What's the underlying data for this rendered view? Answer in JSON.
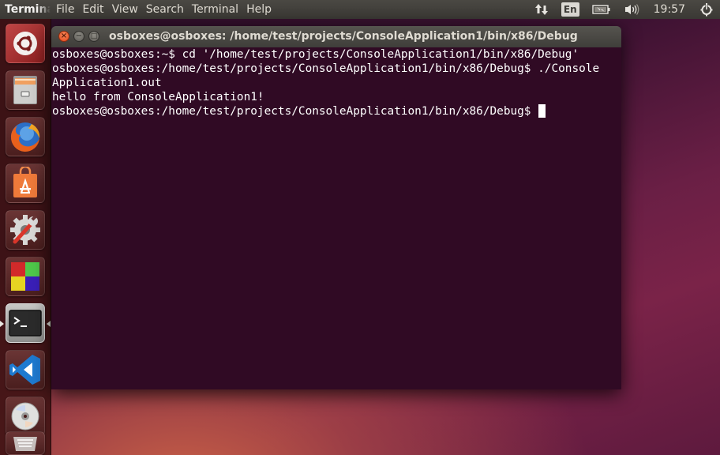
{
  "top_panel": {
    "app_name": "Terminal",
    "menu": [
      "File",
      "Edit",
      "View",
      "Search",
      "Terminal",
      "Help"
    ],
    "indicators": {
      "network_icon": "network-updown-icon",
      "keyboard_layout": "En",
      "battery_icon": "battery-charging-icon",
      "volume_icon": "volume-icon",
      "clock": "19:57",
      "power_icon": "power-gear-icon"
    }
  },
  "launcher": {
    "items": [
      {
        "name": "Dash Home",
        "icon": "ubuntu-logo-icon"
      },
      {
        "name": "Files",
        "icon": "file-cabinet-icon"
      },
      {
        "name": "Firefox Web Browser",
        "icon": "firefox-icon"
      },
      {
        "name": "Ubuntu Software Center",
        "icon": "software-center-bag-icon"
      },
      {
        "name": "System Settings",
        "icon": "settings-wrench-gear-icon"
      },
      {
        "name": "Workspace Switcher",
        "icon": "workspace-switcher-icon"
      },
      {
        "name": "Terminal",
        "icon": "terminal-icon",
        "active": true
      },
      {
        "name": "Visual Studio Code",
        "icon": "vscode-icon"
      },
      {
        "name": "CD/DVD",
        "icon": "optical-disc-icon"
      },
      {
        "name": "Trash",
        "icon": "trash-icon"
      }
    ]
  },
  "window": {
    "title": "osboxes@osboxes: /home/test/projects/ConsoleApplication1/bin/x86/Debug",
    "buttons": {
      "close": "×",
      "minimize": "−",
      "maximize": "□"
    }
  },
  "terminal": {
    "colors": {
      "background": "#300a24",
      "foreground": "#ffffff"
    },
    "lines": [
      "osboxes@osboxes:~$ cd '/home/test/projects/ConsoleApplication1/bin/x86/Debug'",
      "osboxes@osboxes:/home/test/projects/ConsoleApplication1/bin/x86/Debug$ ./Console",
      "Application1.out",
      "hello from ConsoleApplication1!",
      "osboxes@osboxes:/home/test/projects/ConsoleApplication1/bin/x86/Debug$ "
    ]
  }
}
